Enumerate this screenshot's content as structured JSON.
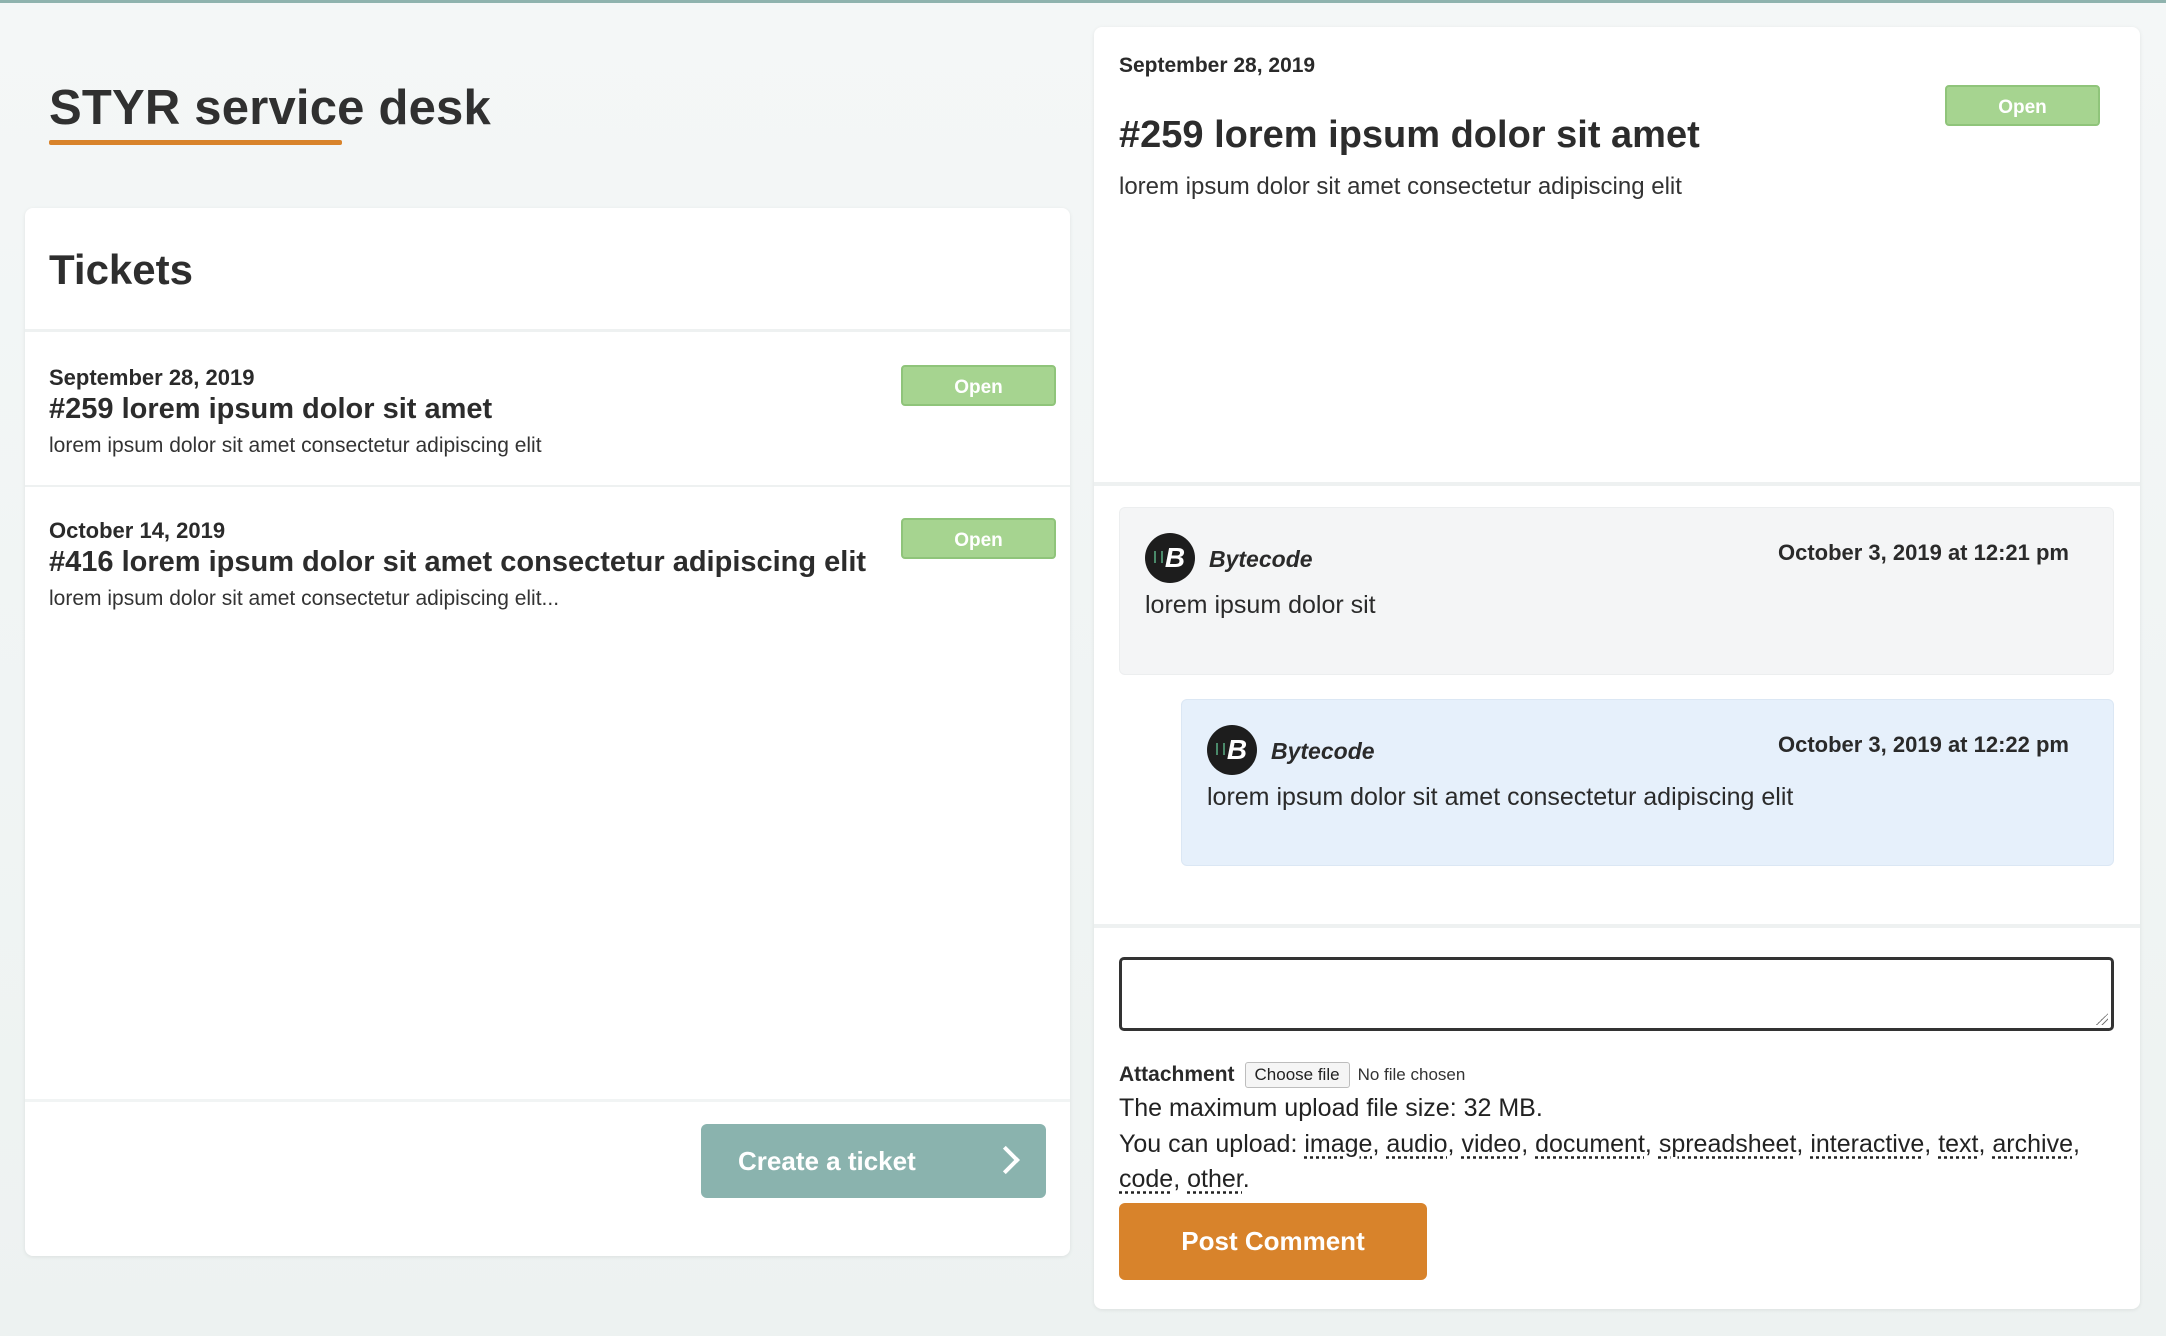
{
  "app": {
    "title": "STYR service desk"
  },
  "tickets": {
    "heading": "Tickets",
    "items": [
      {
        "date": "September 28, 2019",
        "title": "#259 lorem ipsum dolor sit amet",
        "description": "lorem ipsum dolor sit amet consectetur adipiscing elit",
        "status": "Open"
      },
      {
        "date": "October 14, 2019",
        "title": "#416 lorem ipsum dolor sit amet consectetur adipiscing elit",
        "description": "lorem ipsum dolor sit amet consectetur adipiscing elit...",
        "status": "Open"
      }
    ],
    "create_label": "Create a ticket"
  },
  "detail": {
    "date": "September 28, 2019",
    "title": "#259 lorem ipsum dolor sit amet",
    "description": "lorem ipsum dolor sit amet consectetur adipiscing elit",
    "status": "Open",
    "comments": [
      {
        "author": "Bytecode",
        "avatar_letter": "B",
        "time": "October 3, 2019 at 12:21 pm",
        "body": "lorem ipsum dolor sit"
      },
      {
        "author": "Bytecode",
        "avatar_letter": "B",
        "time": "October 3, 2019 at 12:22 pm",
        "body": "lorem ipsum dolor sit amet consectetur adipiscing elit"
      }
    ]
  },
  "comment_form": {
    "input_value": "",
    "attachment_label": "Attachment",
    "choose_file_label": "Choose file",
    "no_file_label": "No file chosen",
    "max_size_text": "The maximum upload file size: 32 MB.",
    "upload_intro": "You can upload:",
    "upload_types": [
      "image",
      "audio",
      "video",
      "document",
      "spreadsheet",
      "interactive",
      "text",
      "archive",
      "code",
      "other"
    ],
    "post_label": "Post Comment"
  },
  "colors": {
    "accent_orange": "#d8832b",
    "teal_button": "#8ab3ae",
    "status_open": "#a6d490",
    "reply_bg": "#e6f0fb"
  }
}
